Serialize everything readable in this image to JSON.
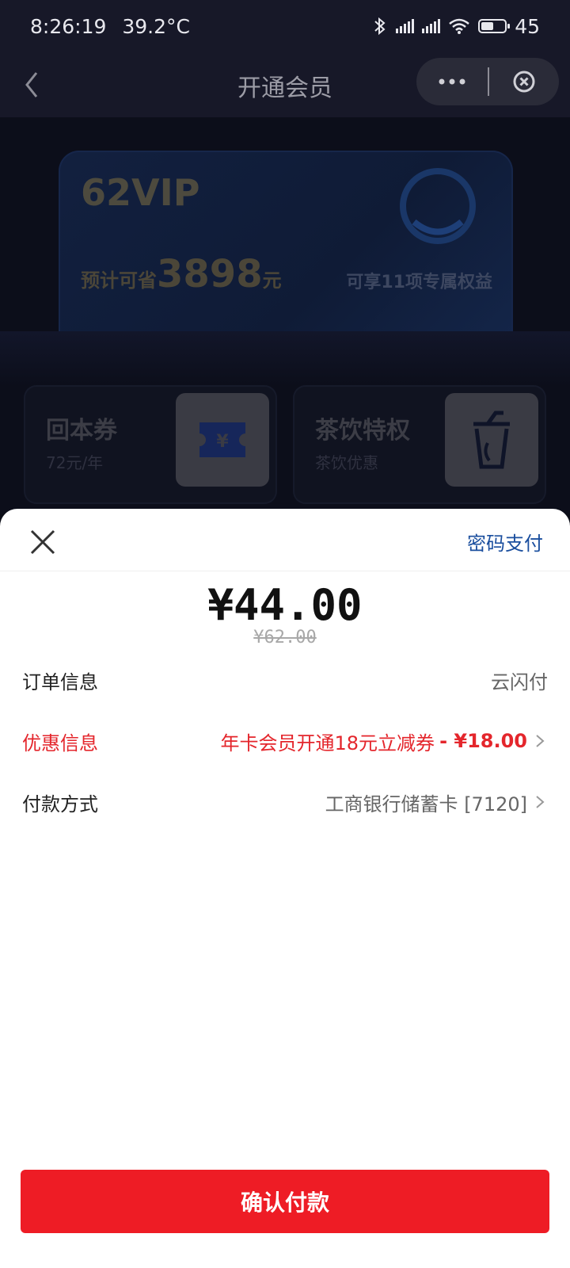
{
  "status_bar": {
    "time": "8:26:19",
    "temperature": "39.2°C",
    "battery": "45"
  },
  "nav": {
    "title": "开通会员",
    "icons": [
      "back-icon",
      "more-icon",
      "close-circle-icon"
    ]
  },
  "background": {
    "vip_card": {
      "title": "62VIP",
      "save_prefix": "预计可省",
      "save_amount": "3898",
      "save_suffix": "元",
      "benefits": "可享11项专属权益"
    },
    "perks": [
      {
        "title": "回本券",
        "subtitle": "72元/年",
        "icon": "coupon-icon"
      },
      {
        "title": "茶饮特权",
        "subtitle": "茶饮优惠",
        "icon": "cup-icon"
      }
    ]
  },
  "sheet": {
    "password_pay": "密码支付",
    "amount": "¥44.00",
    "original_amount": "¥62.00",
    "rows": {
      "order": {
        "label": "订单信息",
        "value": "云闪付"
      },
      "discount": {
        "label": "优惠信息",
        "value": "年卡会员开通18元立减券",
        "amount": "- ¥18.00"
      },
      "method": {
        "label": "付款方式",
        "value": "工商银行储蓄卡 [7120]"
      }
    },
    "confirm_label": "确认付款"
  },
  "colors": {
    "accent_red": "#ee1c25",
    "link_blue": "#1a4e9e",
    "discount_red": "#e4262c"
  }
}
